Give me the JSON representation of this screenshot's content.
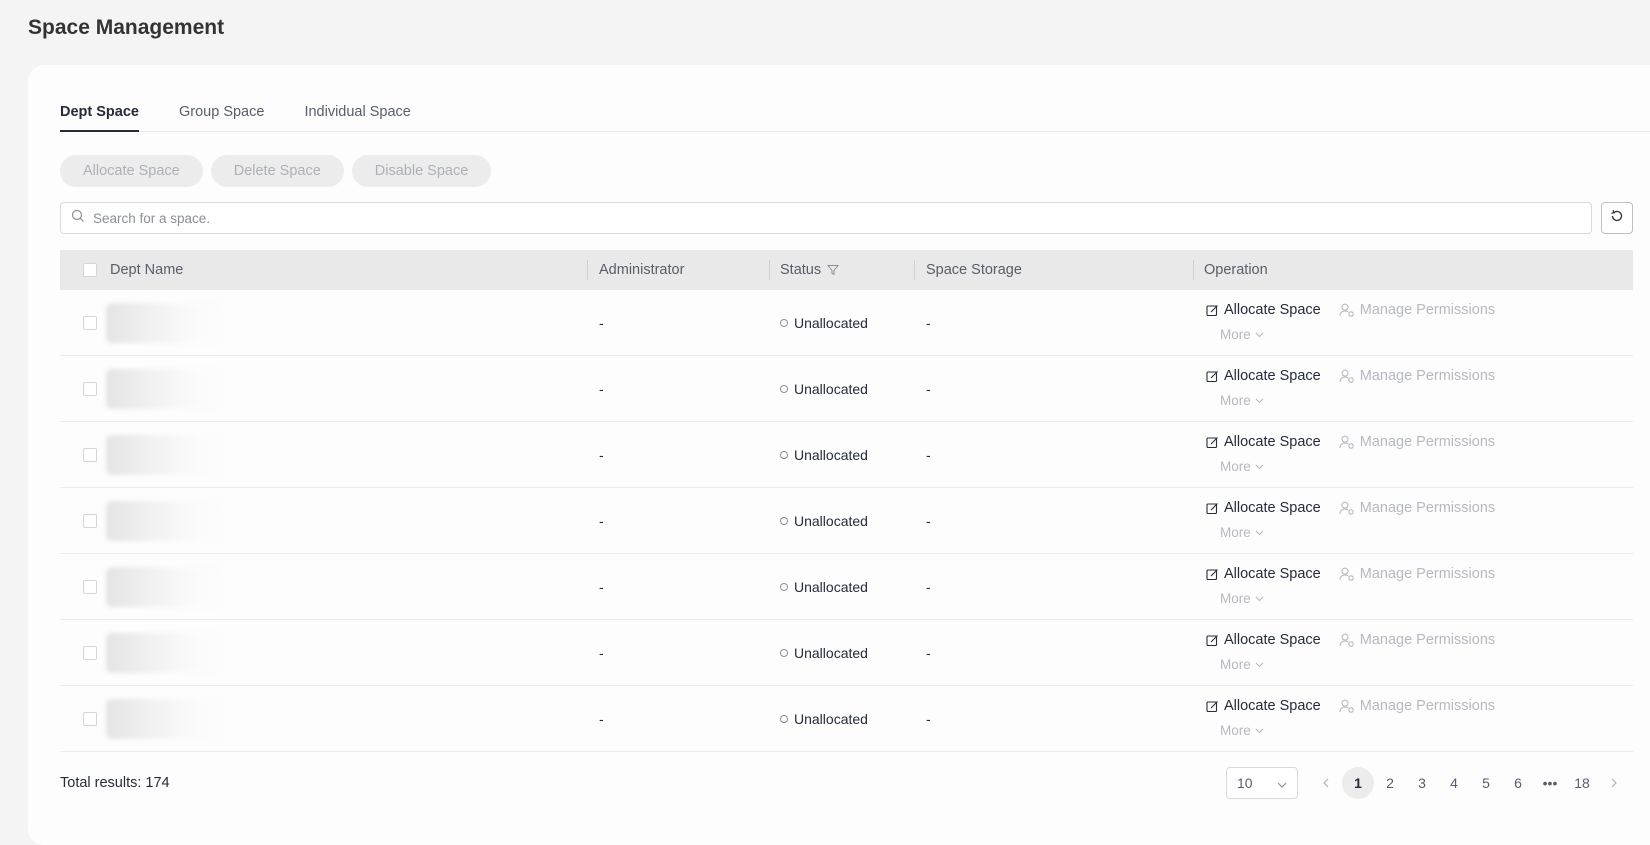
{
  "page_title": "Space Management",
  "tabs": [
    {
      "label": "Dept Space",
      "active": true
    },
    {
      "label": "Group Space",
      "active": false
    },
    {
      "label": "Individual Space",
      "active": false
    }
  ],
  "toolbar": {
    "allocate_label": "Allocate Space",
    "delete_label": "Delete Space",
    "disable_label": "Disable Space"
  },
  "search": {
    "placeholder": "Search for a space.",
    "value": ""
  },
  "table": {
    "columns": {
      "dept_name": "Dept Name",
      "administrator": "Administrator",
      "status": "Status",
      "space_storage": "Space Storage",
      "operation": "Operation"
    },
    "rows": [
      {
        "dept_name": "",
        "administrator": "-",
        "status": "Unallocated",
        "space_storage": "-"
      },
      {
        "dept_name": "",
        "administrator": "-",
        "status": "Unallocated",
        "space_storage": "-"
      },
      {
        "dept_name": "",
        "administrator": "-",
        "status": "Unallocated",
        "space_storage": "-"
      },
      {
        "dept_name": "",
        "administrator": "-",
        "status": "Unallocated",
        "space_storage": "-"
      },
      {
        "dept_name": "",
        "administrator": "-",
        "status": "Unallocated",
        "space_storage": "-"
      },
      {
        "dept_name": "",
        "administrator": "-",
        "status": "Unallocated",
        "space_storage": "-"
      },
      {
        "dept_name": "",
        "administrator": "-",
        "status": "Unallocated",
        "space_storage": "-"
      }
    ],
    "operations": {
      "allocate": "Allocate Space",
      "manage": "Manage Permissions",
      "more": "More"
    }
  },
  "footer": {
    "total_text": "Total results: 174",
    "page_size": "10",
    "pages": [
      "1",
      "2",
      "3",
      "4",
      "5",
      "6",
      "•••",
      "18"
    ],
    "current_page": "1"
  }
}
